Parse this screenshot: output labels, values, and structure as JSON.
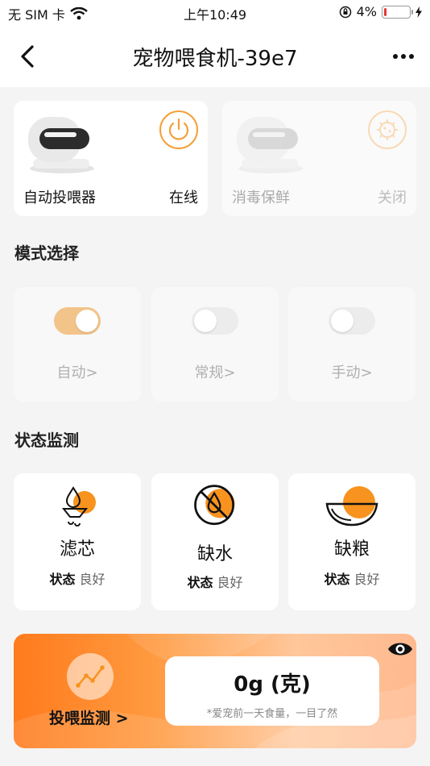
{
  "status_bar": {
    "carrier": "无 SIM 卡",
    "time": "上午10:49",
    "battery": "4%",
    "battery_level": 0.04
  },
  "nav": {
    "title": "宠物喂食机-39e7"
  },
  "devices": [
    {
      "name": "自动投喂器",
      "status": "在线",
      "icon": "power-icon"
    },
    {
      "name": "消毒保鲜",
      "status": "关闭",
      "icon": "germ-icon"
    }
  ],
  "mode_section": {
    "title": "模式选择"
  },
  "modes": [
    {
      "label": "自动>",
      "on": true
    },
    {
      "label": "常规>",
      "on": false
    },
    {
      "label": "手动>",
      "on": false
    }
  ],
  "status_section": {
    "title": "状态监测"
  },
  "statuses": [
    {
      "name": "滤芯",
      "key": "状态",
      "value": "良好",
      "icon": "filter-drop-icon"
    },
    {
      "name": "缺水",
      "key": "状态",
      "value": "良好",
      "icon": "no-water-icon"
    },
    {
      "name": "缺粮",
      "key": "状态",
      "value": "良好",
      "icon": "bowl-icon"
    }
  ],
  "feed_monitor": {
    "label": "投喂监测 >",
    "value": "0g (克)",
    "note": "*爱宠前一天食量，一目了然"
  },
  "colors": {
    "accent": "#f5a03a",
    "orange": "#f7931e"
  }
}
